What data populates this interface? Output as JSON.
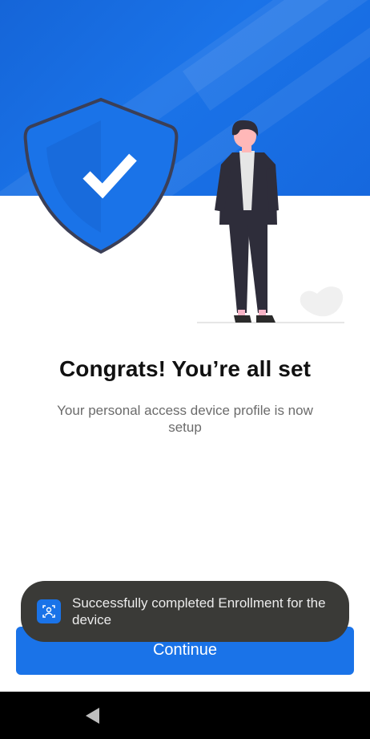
{
  "colors": {
    "primary": "#1a73e8",
    "toast_background": "#3a3a37",
    "navbar": "#000000"
  },
  "main": {
    "title": "Congrats! You’re all set",
    "subtitle": "Your personal access device profile is now setup"
  },
  "toast": {
    "icon": "app-icon",
    "message": "Successfully completed Enrollment for the device"
  },
  "footer": {
    "continue_label": "Continue"
  },
  "navbar": {
    "back_icon": "back-triangle-icon"
  }
}
